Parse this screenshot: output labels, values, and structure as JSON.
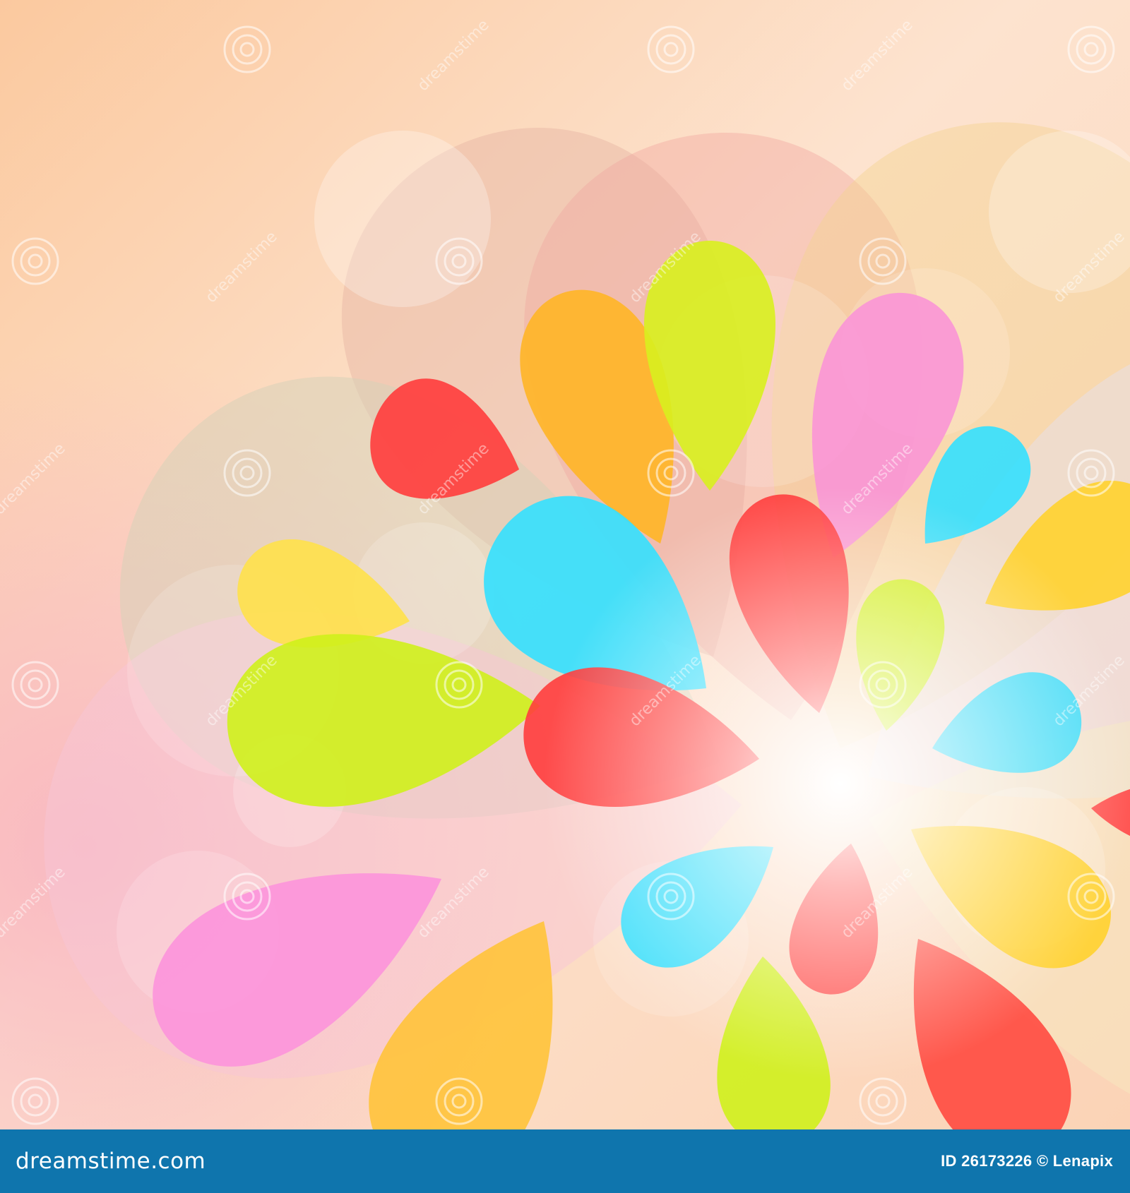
{
  "footer": {
    "brand": "dreamstime.com",
    "image_id": "ID 26173226",
    "credit": "© Lenapix",
    "background_color": "#0f75ad"
  },
  "watermark": {
    "text": "dreamstime",
    "icon": "spiral-icon"
  },
  "palette": {
    "red": "#ff4444",
    "orange": "#ffb830",
    "lime": "#d8f020",
    "cyan": "#3ddcf7",
    "pink": "#f8a0dc",
    "yellow": "#ffd84a"
  }
}
